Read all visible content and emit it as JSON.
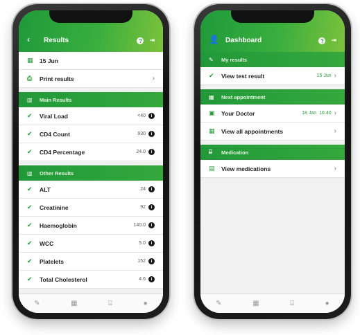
{
  "results_screen": {
    "title": "Results",
    "back_icon": "back-arrow-icon",
    "date": "15 Jun",
    "print_label": "Print results",
    "main_section": "Main Results",
    "main_rows": [
      {
        "label": "Viral Load",
        "value": "<40"
      },
      {
        "label": "CD4 Count",
        "value": "930"
      },
      {
        "label": "CD4 Percentage",
        "value": "24.0"
      }
    ],
    "other_section": "Other Results",
    "other_rows": [
      {
        "label": "ALT",
        "value": "24"
      },
      {
        "label": "Creatinine",
        "value": "92"
      },
      {
        "label": "Haemoglobin",
        "value": "140.0"
      },
      {
        "label": "WCC",
        "value": "5.0"
      },
      {
        "label": "Platelets",
        "value": "152"
      },
      {
        "label": "Total Cholesterol",
        "value": "4.6"
      }
    ]
  },
  "dashboard_screen": {
    "title": "Dashboard",
    "my_results_section": "My results",
    "view_test_result": "View test result",
    "view_test_result_date": "15 Jun",
    "next_appointment_section": "Next appointment",
    "your_doctor": "Your Doctor",
    "your_doctor_date": "18 Jan",
    "your_doctor_time": "16:40",
    "view_all_appointments": "View all appointments",
    "medication_section": "Medication",
    "view_medications": "View medications"
  },
  "tabbar_icons": [
    "pen-icon",
    "calendar-icon",
    "medication-bottle-icon",
    "chat-bubble-icon"
  ],
  "colors": {
    "accent_green": "#2b9c3a",
    "header_gradient_end": "#7cc23c"
  }
}
